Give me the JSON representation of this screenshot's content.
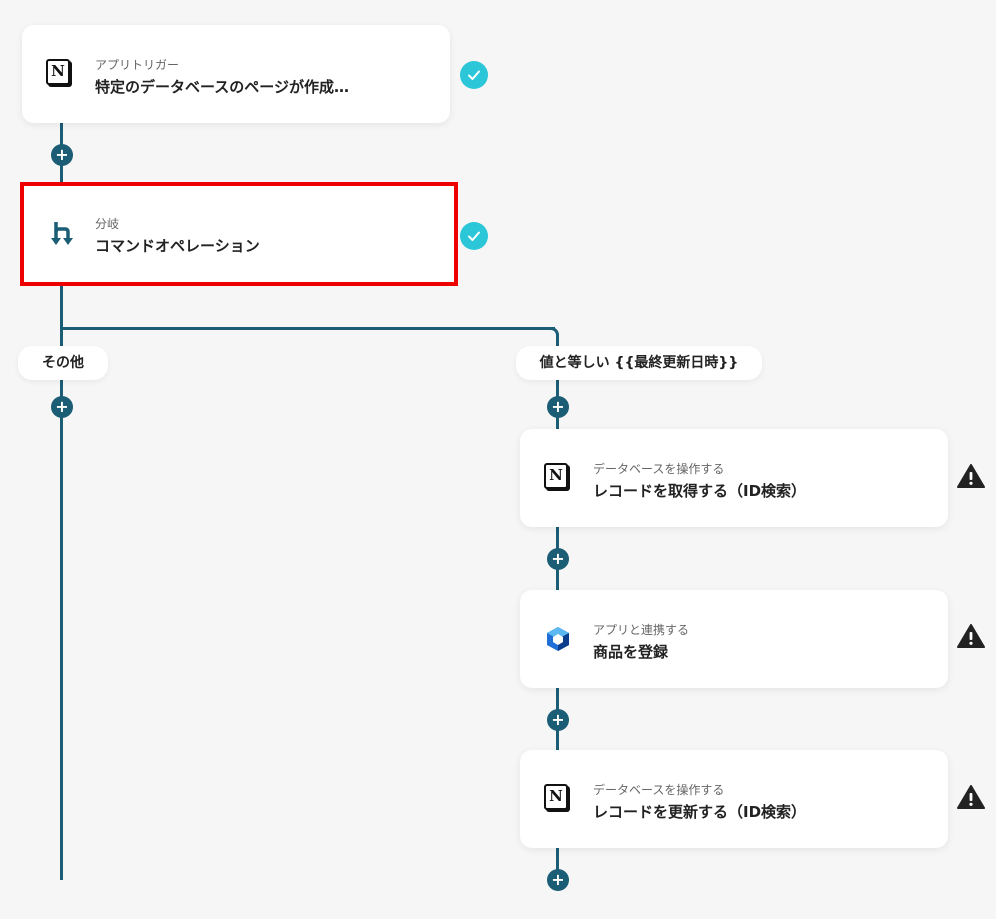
{
  "steps": [
    {
      "subtitle": "アプリトリガー",
      "title": "特定のデータベースのページが作成…",
      "icon": "notion-icon"
    },
    {
      "subtitle": "分岐",
      "title": "コマンドオペレーション",
      "icon": "branch-icon"
    },
    {
      "subtitle": "データベースを操作する",
      "title": "レコードを取得する（ID検索）",
      "icon": "notion-icon"
    },
    {
      "subtitle": "アプリと連携する",
      "title": "商品を登録",
      "icon": "cube-app-icon"
    },
    {
      "subtitle": "データベースを操作する",
      "title": "レコードを更新する（ID検索）",
      "icon": "notion-icon"
    }
  ],
  "branches": {
    "left_label": "その他",
    "right_label": "値と等しい {{最終更新日時}}"
  },
  "glyphs": {
    "plus": "+",
    "notion_letter": "N"
  },
  "colors": {
    "connector": "#1a5d74",
    "check": "#2bc7d9",
    "selected_border": "#ee0000",
    "warning": "#222222"
  }
}
